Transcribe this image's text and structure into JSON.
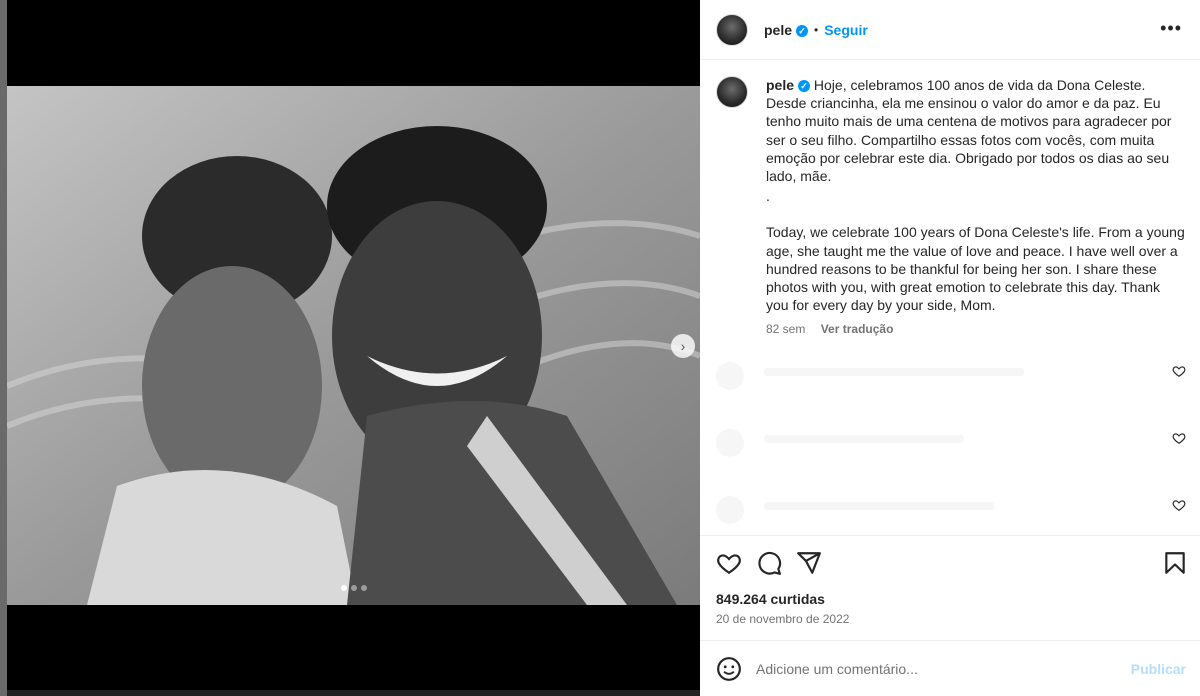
{
  "post": {
    "username": "pele",
    "follow_label": "Seguir",
    "more_glyph": "•••",
    "verified_glyph": "✓",
    "separator": "•"
  },
  "media": {
    "next_glyph": "›",
    "carousel_count": 3,
    "carousel_active": 1
  },
  "caption": {
    "username": "pele",
    "text_pt": "Hoje, celebramos 100 anos de vida da Dona Celeste. Desde criancinha, ela me ensinou o valor do amor e da paz. Eu tenho muito mais de uma centena de motivos para agradecer por ser o seu filho. Compartilho essas fotos com vocês, com muita emoção por celebrar este dia. Obrigado por todos os dias ao seu lado, mãe.",
    "divider": ".",
    "text_en": "Today, we celebrate 100 years of Dona Celeste's life. From a young age, she taught me the value of love and peace. I have well over a hundred reasons to be thankful for being her son. I share these photos with you, with great emotion to celebrate this day. Thank you for every day by your side, Mom.",
    "age": "82 sem",
    "translate_label": "Ver tradução"
  },
  "stats": {
    "likes": "849.264 curtidas",
    "date": "20 de novembro de 2022"
  },
  "comment_box": {
    "placeholder": "Adicione um comentário...",
    "publish_label": "Publicar"
  },
  "icons": {
    "like": "heart-icon",
    "comment": "comment-icon",
    "share": "share-icon",
    "save": "bookmark-icon",
    "emoji": "emoji-icon"
  },
  "colors": {
    "accent": "#0095f6",
    "publish_disabled": "#b2dffc",
    "text": "#262626",
    "muted": "#737373"
  }
}
